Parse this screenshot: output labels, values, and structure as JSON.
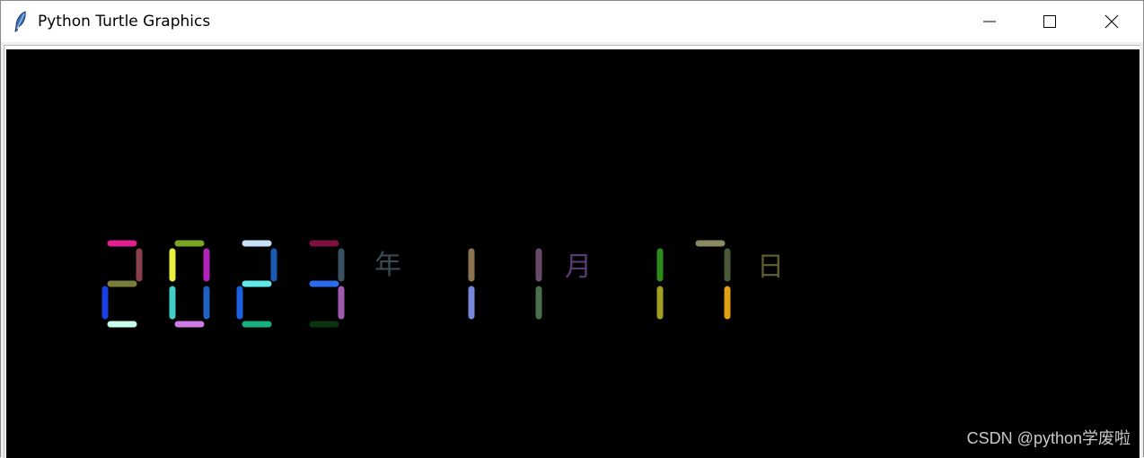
{
  "window": {
    "title": "Python Turtle Graphics",
    "icon": "feather-icon",
    "controls": [
      "minimize-icon",
      "maximize-icon",
      "close-icon"
    ]
  },
  "display": {
    "background": "#000000",
    "date_text": "2023年11月17日",
    "units": {
      "year": {
        "text": "年",
        "color": "#3a4a56"
      },
      "month": {
        "text": "月",
        "color": "#5a3a72"
      },
      "day": {
        "text": "日",
        "color": "#5c5c30"
      }
    },
    "digits": [
      {
        "value": "2",
        "colors": {
          "a": "#e0208f",
          "b": "#8a3f4e",
          "g": "#7a7c3c",
          "e": "#1a3fe0",
          "d": "#c8ffe8"
        }
      },
      {
        "value": "0",
        "colors": {
          "a": "#7aa524",
          "b": "#b222b8",
          "c": "#2060c0",
          "d": "#d07ae8",
          "e": "#40d0c8",
          "f": "#e8f040"
        }
      },
      {
        "value": "2",
        "colors": {
          "a": "#c8e0f8",
          "b": "#1a5ab0",
          "g": "#60e8e8",
          "e": "#1a60e0",
          "d": "#18b080"
        }
      },
      {
        "value": "3",
        "colors": {
          "a": "#7c1040",
          "b": "#3a5060",
          "g": "#2a6aec",
          "c": "#a058b0",
          "d": "#0c3410"
        }
      },
      {
        "value": "1",
        "colors": {
          "b": "#8a7450",
          "c": "#7888d8"
        }
      },
      {
        "value": "1",
        "colors": {
          "b": "#6a4a6a",
          "c": "#4a7050"
        }
      },
      {
        "value": "1",
        "colors": {
          "b": "#2a8a1a",
          "c": "#a0a020"
        }
      },
      {
        "value": "7",
        "colors": {
          "a": "#8a8a60",
          "b": "#4a5a38",
          "c": "#e0a010"
        }
      }
    ]
  },
  "watermark": "CSDN @python学废啦"
}
